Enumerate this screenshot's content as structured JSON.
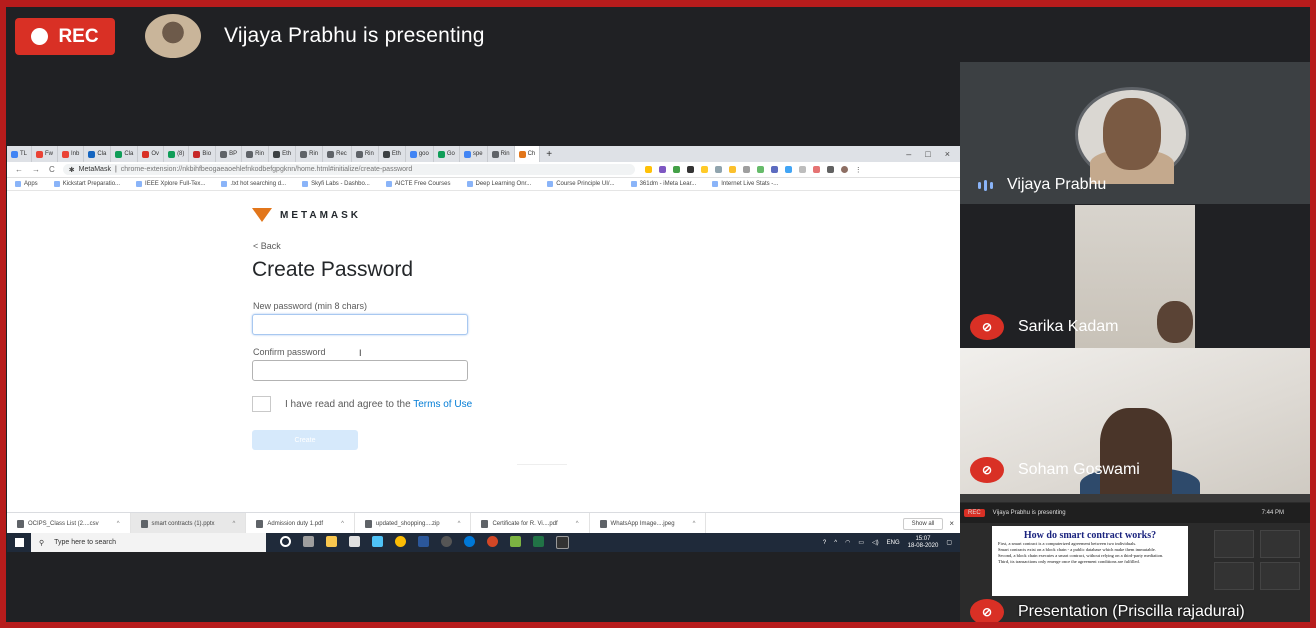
{
  "meet": {
    "rec_label": "REC",
    "presenting_text": "Vijaya Prabhu is presenting"
  },
  "browser": {
    "tabs": [
      "TL",
      "Fw",
      "Inb",
      "Cla",
      "Cla",
      "Ov",
      "(8)",
      "Bio",
      "BP",
      "Rin",
      "Eth",
      "Rin",
      "Rec",
      "Rin",
      "Eth",
      "goo",
      "Go",
      "spe",
      "Rin",
      "Ch"
    ],
    "new_tab": "+",
    "url_site": "MetaMask",
    "url_path": "chrome-extension://nkbihfbeogaeaoehlefnkodbefgpgknn/home.html#initialize/create-password",
    "bookmarks": [
      "Apps",
      "Kickstart Preparatio...",
      "IEEE Xplore Full-Tex...",
      ".txt hot searching d...",
      "Skyfi Labs - Dashbo...",
      "AICTE Free Courses",
      "Deep Learning Onr...",
      "Course Principle UI/...",
      "361dm - iMeta Lear...",
      "Internet Live Stats -..."
    ],
    "window_controls": [
      "–",
      "□",
      "×"
    ]
  },
  "metamask": {
    "brand": "METAMASK",
    "back": "< Back",
    "title": "Create Password",
    "new_password_label": "New password (min 8 chars)",
    "confirm_password_label": "Confirm password",
    "terms_prefix": "I have read and agree to the ",
    "terms_link": "Terms of Use",
    "create_button": "Create"
  },
  "downloads": {
    "items": [
      "OCIPS_Class List (2....csv",
      "smart contracts (1).pptx",
      "Admission duty 1.pdf",
      "updated_shopping....zip",
      "Certificate for R. Vi....pdf",
      "WhatsApp Image....jpeg"
    ],
    "show_all": "Show all"
  },
  "taskbar": {
    "search_placeholder": "Type here to search",
    "lang": "ENG",
    "time": "15:07",
    "date": "18-08-2020"
  },
  "participants": [
    {
      "name": "Vijaya Prabhu",
      "muted": false
    },
    {
      "name": "Sarika Kadam",
      "muted": true
    },
    {
      "name": "Soham Goswami",
      "muted": true
    },
    {
      "name": "Presentation (Priscilla rajadurai)",
      "muted": true
    }
  ],
  "presentation_thumb": {
    "meet_bar_text": "Vijaya Prabhu is presenting",
    "slide_title": "How do smart contract works?",
    "slide_lines": [
      "First, a smart contract is a computerized agreement between two individuals.",
      "Smart contracts exist on a block chain - a public database which make them immutable.",
      "Second, a block chain executes a smart contract, without relying on a third-party mediation.",
      "Third, its transactions only emerge once the agreement conditions are fulfilled."
    ],
    "time": "7:44 PM"
  }
}
